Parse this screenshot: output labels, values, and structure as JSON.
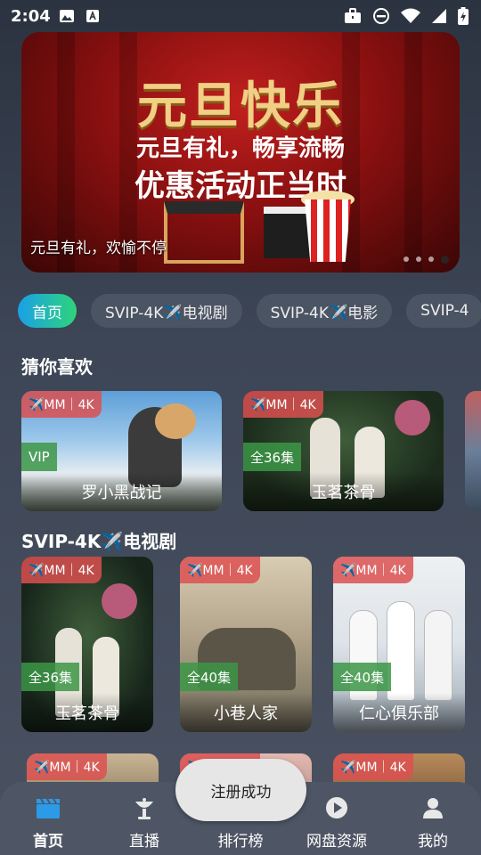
{
  "status_bar": {
    "time": "2:04"
  },
  "banner": {
    "title": "元旦快乐",
    "subtitle1": "元旦有礼，畅享流畅",
    "subtitle2": "优惠活动正当时",
    "caption": "元旦有礼，欢愉不停"
  },
  "tabs": [
    {
      "label": "首页"
    },
    {
      "label": "SVIP-4K✈️电视剧"
    },
    {
      "label": "SVIP-4K✈️电影"
    },
    {
      "label": "SVIP-4"
    }
  ],
  "sections": {
    "guess": {
      "title": "猜你喜欢",
      "cards": [
        {
          "badge": "✈️MM｜4K",
          "tag": "VIP",
          "title": "罗小黑战记"
        },
        {
          "badge": "✈️MM｜4K",
          "tag": "全36集",
          "title": "玉茗茶骨"
        }
      ]
    },
    "tv": {
      "title": "SVIP-4K✈️电视剧",
      "cards": [
        {
          "badge": "✈️MM｜4K",
          "tag": "全36集",
          "title": "玉茗茶骨"
        },
        {
          "badge": "✈️MM｜4K",
          "tag": "全40集",
          "title": "小巷人家"
        },
        {
          "badge": "✈️MM｜4K",
          "tag": "全40集",
          "title": "仁心俱乐部"
        }
      ],
      "row2_badges": [
        "✈️MM｜4K",
        "✈️MM｜4K",
        "✈️MM｜4K"
      ]
    }
  },
  "toast": "注册成功",
  "bottom_nav": [
    {
      "label": "首页",
      "icon": "clapperboard-icon",
      "active": true
    },
    {
      "label": "直播",
      "icon": "satellite-dish-icon"
    },
    {
      "label": "排行榜",
      "icon": "bar-chart-icon"
    },
    {
      "label": "网盘资源",
      "icon": "play-circle-icon"
    },
    {
      "label": "我的",
      "icon": "user-icon"
    }
  ],
  "colors": {
    "accent_start": "#1aa0e8",
    "accent_end": "#2ed47a",
    "badge_red": "#dc5050",
    "badge_green": "#3c9646"
  }
}
